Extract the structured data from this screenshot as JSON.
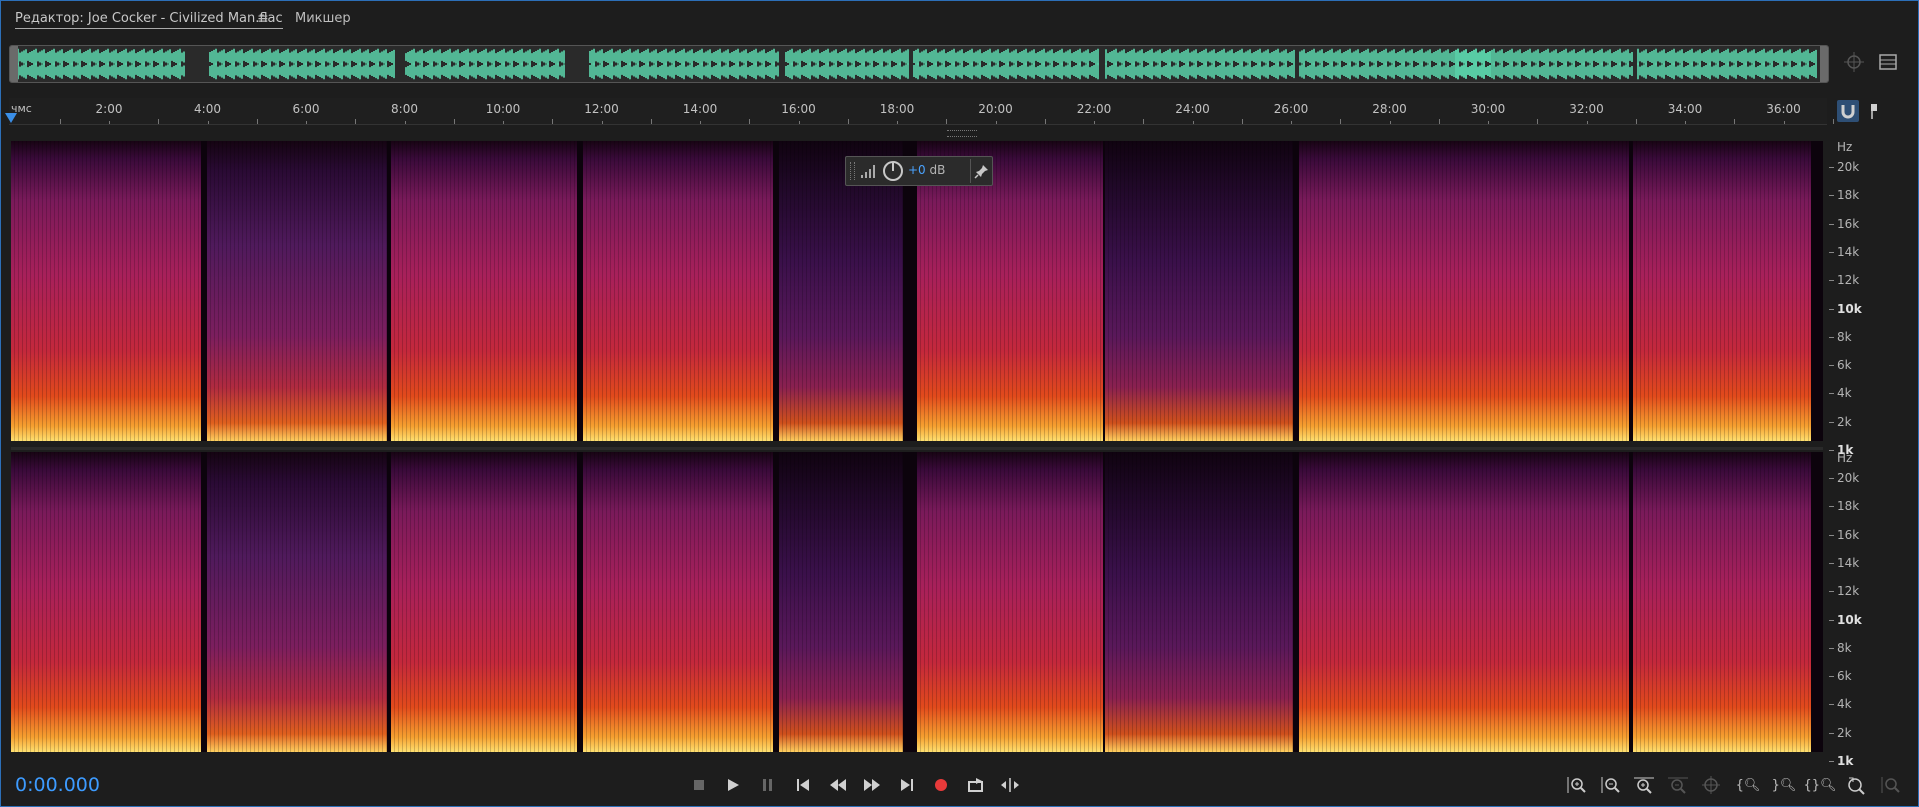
{
  "tabs": {
    "editor_label": "Редактор: Joe Cocker - Civilized Man.flac",
    "mixer_label": "Микшер"
  },
  "ruler": {
    "unit_label": "чмс",
    "ticks": [
      "2:00",
      "4:00",
      "6:00",
      "8:00",
      "10:00",
      "12:00",
      "14:00",
      "16:00",
      "18:00",
      "20:00",
      "22:00",
      "24:00",
      "26:00",
      "28:00",
      "30:00",
      "32:00",
      "34:00",
      "36:00"
    ]
  },
  "frequency_axis": {
    "unit": "Hz",
    "labels": [
      "20k",
      "18k",
      "16k",
      "14k",
      "12k",
      "10k",
      "8k",
      "6k",
      "4k",
      "2k",
      "1k"
    ]
  },
  "hud": {
    "gain_value": "+0",
    "gain_unit": "dB"
  },
  "transport": {
    "time_display": "0:00.000"
  },
  "colors": {
    "accent": "#3d9bff",
    "waveform": "#5ddbb0",
    "record": "#e83a3a"
  },
  "icons": [
    "stop-icon",
    "play-icon",
    "pause-icon",
    "go-to-start-icon",
    "rewind-icon",
    "fast-forward-icon",
    "go-to-end-icon",
    "record-icon",
    "loop-icon",
    "skip-selection-icon",
    "zoom-in-amplitude-icon",
    "zoom-out-amplitude-icon",
    "zoom-in-time-icon",
    "zoom-out-time-icon",
    "zoom-full-icon",
    "zoom-in-left-icon",
    "zoom-in-right-icon",
    "zoom-selection-icon",
    "zoom-reset-icon",
    "snap-magnet-icon",
    "marker-icon",
    "hud-pin-icon"
  ]
}
